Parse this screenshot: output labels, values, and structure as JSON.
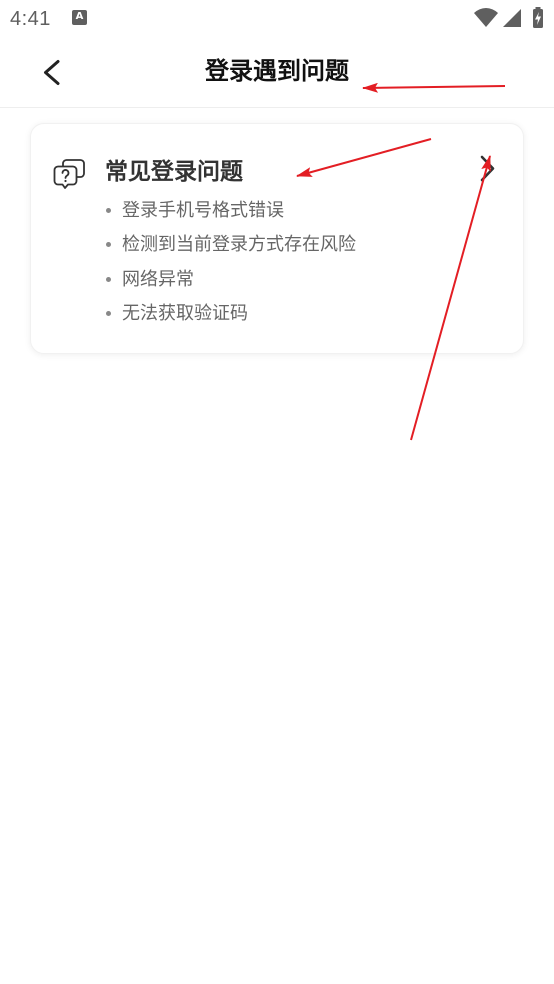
{
  "status_bar": {
    "time": "4:41",
    "notification": {
      "icon": "app-notification-icon",
      "glyph": "A"
    },
    "icons": {
      "wifi": "wifi-icon",
      "signal": "cellular-signal-icon",
      "battery": "battery-charging-icon"
    }
  },
  "header": {
    "back_icon": "chevron-left-icon",
    "title": "登录遇到问题"
  },
  "faq_card": {
    "icon": "chat-question-icon",
    "title": "常见登录问题",
    "chevron_icon": "chevron-right-icon",
    "items": [
      "登录手机号格式错误",
      "检测到当前登录方式存在风险",
      "网络异常",
      "无法获取验证码"
    ]
  },
  "colors": {
    "background": "#ffffff",
    "status_text": "#5f5f5f",
    "title_text": "#111111",
    "card_title": "#333333",
    "item_text": "#666666",
    "bullet": "#888888",
    "divider": "#eeeeee",
    "annotation": "#e31e24"
  }
}
